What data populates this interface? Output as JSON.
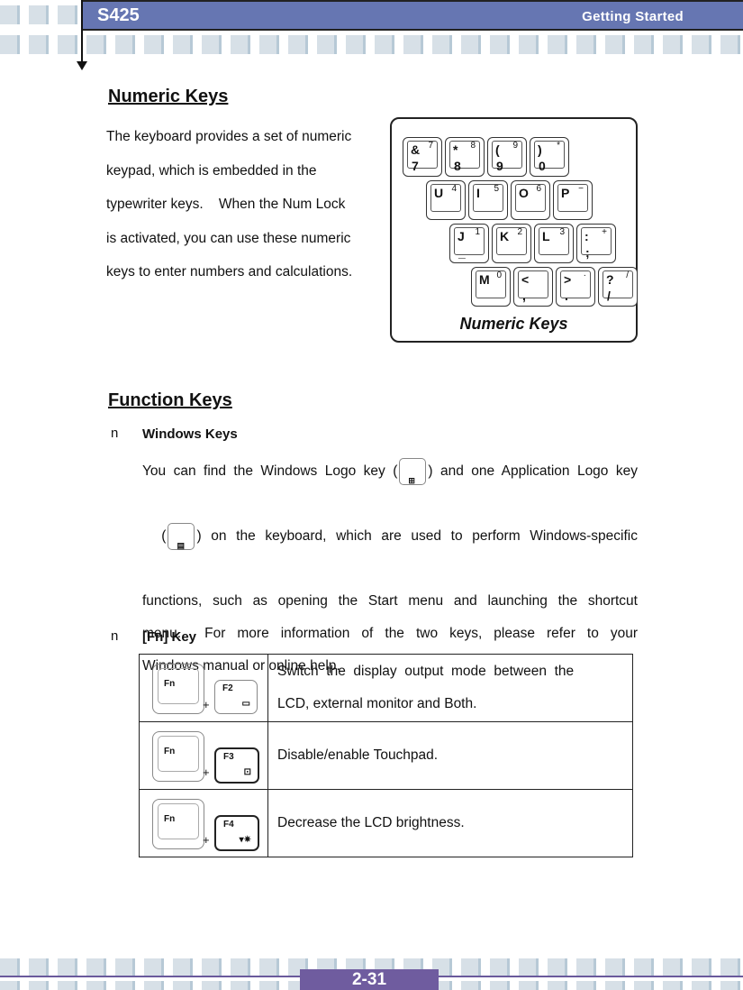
{
  "header": {
    "model": "S425",
    "section": "Getting  Started",
    "band_color": "#6676b2"
  },
  "numeric_keys": {
    "heading": "Numeric Keys",
    "paragraph_lines": [
      "The keyboard provides a set of numeric",
      "keypad, which is embedded in the",
      "typewriter keys.    When the Num Lock",
      "is activated, you can use these numeric",
      "keys to enter numbers and calculations."
    ],
    "figure": {
      "caption": "Numeric Keys",
      "rows": [
        [
          {
            "main": "&",
            "num": "7",
            "low": "7"
          },
          {
            "main": "*",
            "num": "8",
            "low": "8"
          },
          {
            "main": "(",
            "num": "9",
            "low": "9"
          },
          {
            "main": ")",
            "num": "*",
            "low": "0"
          }
        ],
        [
          {
            "main": "U",
            "num": "4",
            "low": ""
          },
          {
            "main": "I",
            "num": "5",
            "low": ""
          },
          {
            "main": "O",
            "num": "6",
            "low": ""
          },
          {
            "main": "P",
            "num": "−",
            "low": ""
          }
        ],
        [
          {
            "main": "J",
            "num": "1",
            "low": "_"
          },
          {
            "main": "K",
            "num": "2",
            "low": ""
          },
          {
            "main": "L",
            "num": "3",
            "low": ""
          },
          {
            "main": ":",
            "num": "+",
            "low": ";"
          }
        ],
        [
          {
            "main": "M",
            "num": "0",
            "low": ""
          },
          {
            "main": "<",
            "num": "",
            "low": ","
          },
          {
            "main": ">",
            "num": "·",
            "low": "."
          },
          {
            "main": "?",
            "num": "/",
            "low": "/"
          }
        ]
      ]
    }
  },
  "function_keys": {
    "heading": "Function Keys",
    "bullet_marker": "n",
    "windows_keys": {
      "title": "Windows Keys",
      "lines": [
        [
          "You can find the Windows Logo key (",
          ") and one Application Logo key"
        ],
        [
          "(",
          ")  on  the  keyboard,  which  are  used  to  perform  Windows-specific"
        ],
        "functions,  such  as  opening  the  Start  menu  and  launching  the  shortcut",
        "menu.    For  more  information  of  the  two  keys,  please  refer  to  your",
        "Windows manual or online help."
      ],
      "windows_key_glyph": "⊞",
      "app_key_glyph": "▤"
    },
    "fn_key": {
      "title": "[Fn] Key",
      "rows": [
        {
          "fn": "Fn",
          "plus": "+",
          "fkey": "F2",
          "symbol": "▭",
          "dark": false,
          "desc_lines": [
            "Switch  the  display  output  mode  between  the",
            "LCD, external monitor and Both."
          ]
        },
        {
          "fn": "Fn",
          "plus": "+",
          "fkey": "F3",
          "symbol": "⊡",
          "dark": true,
          "desc_lines": [
            "Disable/enable Touchpad."
          ]
        },
        {
          "fn": "Fn",
          "plus": "+",
          "fkey": "F4",
          "symbol": "▾✷",
          "dark": true,
          "desc_lines": [
            "Decrease the LCD brightness."
          ]
        }
      ]
    }
  },
  "footer": {
    "page_number": "2-31",
    "color": "#6f5c9f"
  }
}
